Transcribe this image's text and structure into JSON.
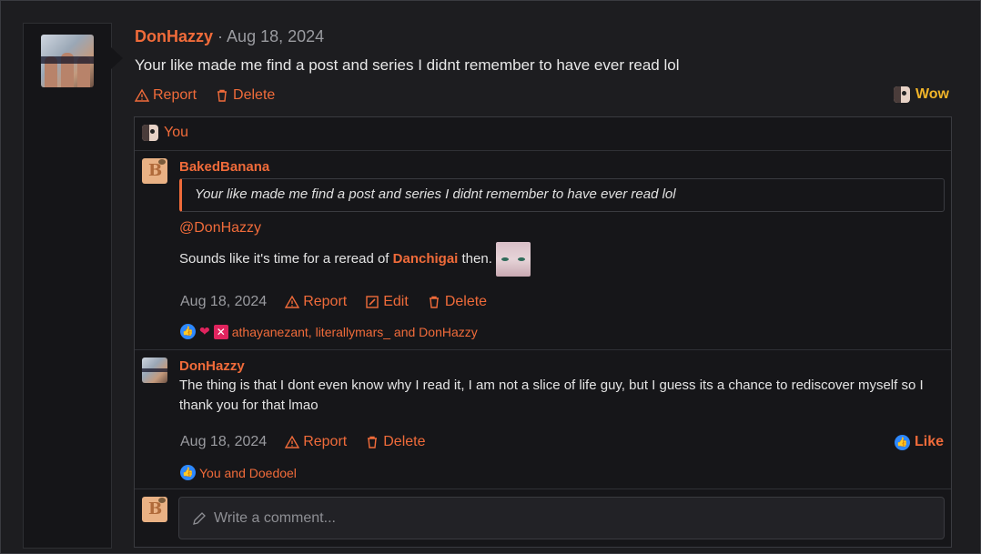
{
  "post": {
    "author": "DonHazzy",
    "separator": "·",
    "date": "Aug 18, 2024",
    "body": "Your like made me find a post and series I didnt remember to have ever read lol",
    "actions": {
      "report": "Report",
      "delete": "Delete"
    },
    "reaction": {
      "label": "Wow",
      "icon": "wow-face-icon"
    }
  },
  "thread": {
    "you_label": "You",
    "comments": [
      {
        "author": "BakedBanana",
        "quote": "Your like made me find a post and series I didnt remember to have ever read lol",
        "mention": "@DonHazzy",
        "text_before": "Sounds like it's time for a reread of ",
        "link": "Danchigai",
        "text_after": " then.",
        "date": "Aug 18, 2024",
        "actions": {
          "report": "Report",
          "edit": "Edit",
          "delete": "Delete"
        },
        "reactions_text": "athayanezant, literallymars_ and DonHazzy"
      },
      {
        "author": "DonHazzy",
        "text": "The thing is that I dont even know why I read it, I am not a slice of life guy, but I guess its a chance to rediscover myself so I thank you for that lmao",
        "date": "Aug 18, 2024",
        "actions": {
          "report": "Report",
          "delete": "Delete"
        },
        "like_label": "Like",
        "reactions_text": "You and Doedoel"
      }
    ],
    "input": {
      "placeholder": "Write a comment..."
    }
  },
  "colors": {
    "accent": "#f06b3a",
    "wow": "#f0b429",
    "like_blue": "#2d88ff",
    "background": "#1d1d20"
  }
}
